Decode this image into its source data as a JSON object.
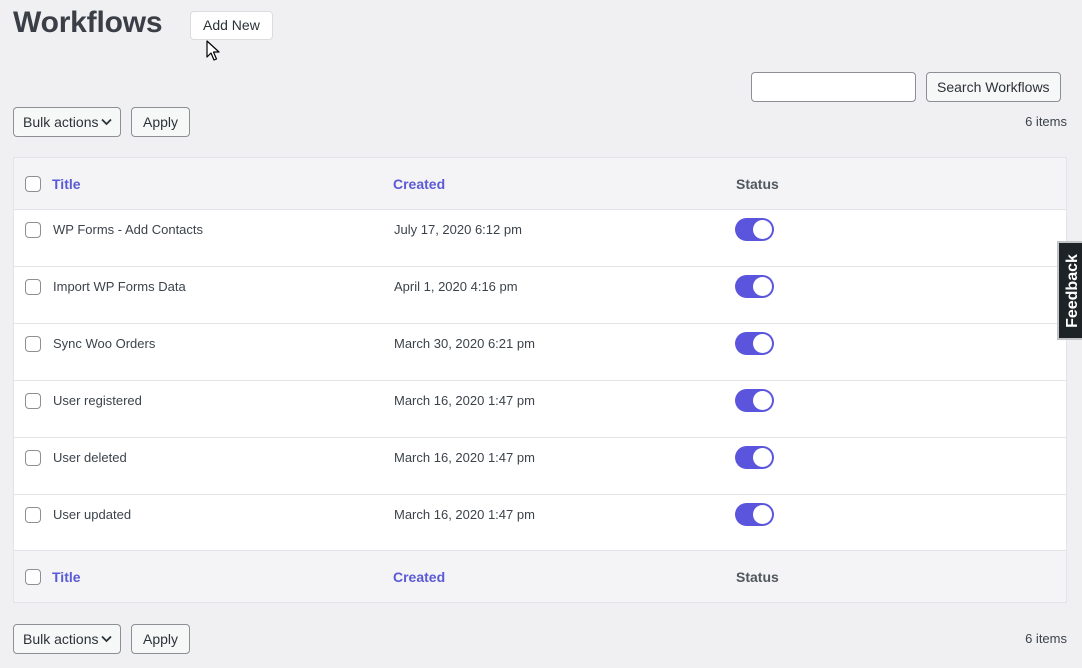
{
  "header": {
    "title": "Workflows",
    "add_new_label": "Add New"
  },
  "search": {
    "value": "",
    "button_label": "Search Workflows"
  },
  "top_nav": {
    "bulk_actions_label": "Bulk actions",
    "apply_label": "Apply",
    "items_count": "6 items"
  },
  "bottom_nav": {
    "bulk_actions_label": "Bulk actions",
    "apply_label": "Apply",
    "items_count": "6 items"
  },
  "table": {
    "columns": [
      "Title",
      "Created",
      "Status"
    ],
    "rows": [
      {
        "title": "WP Forms - Add Contacts",
        "created": "July 17, 2020 6:12 pm",
        "enabled": true
      },
      {
        "title": "Import WP Forms Data",
        "created": "April 1, 2020 4:16 pm",
        "enabled": true
      },
      {
        "title": "Sync Woo Orders",
        "created": "March 30, 2020 6:21 pm",
        "enabled": true
      },
      {
        "title": "User registered",
        "created": "March 16, 2020 1:47 pm",
        "enabled": true
      },
      {
        "title": "User deleted",
        "created": "March 16, 2020 1:47 pm",
        "enabled": true
      },
      {
        "title": "User updated",
        "created": "March 16, 2020 1:47 pm",
        "enabled": true
      }
    ]
  },
  "feedback_label": "Feedback",
  "colors": {
    "accent": "#5b55de",
    "link": "#5b5ad6",
    "background": "#f0f0f3"
  }
}
